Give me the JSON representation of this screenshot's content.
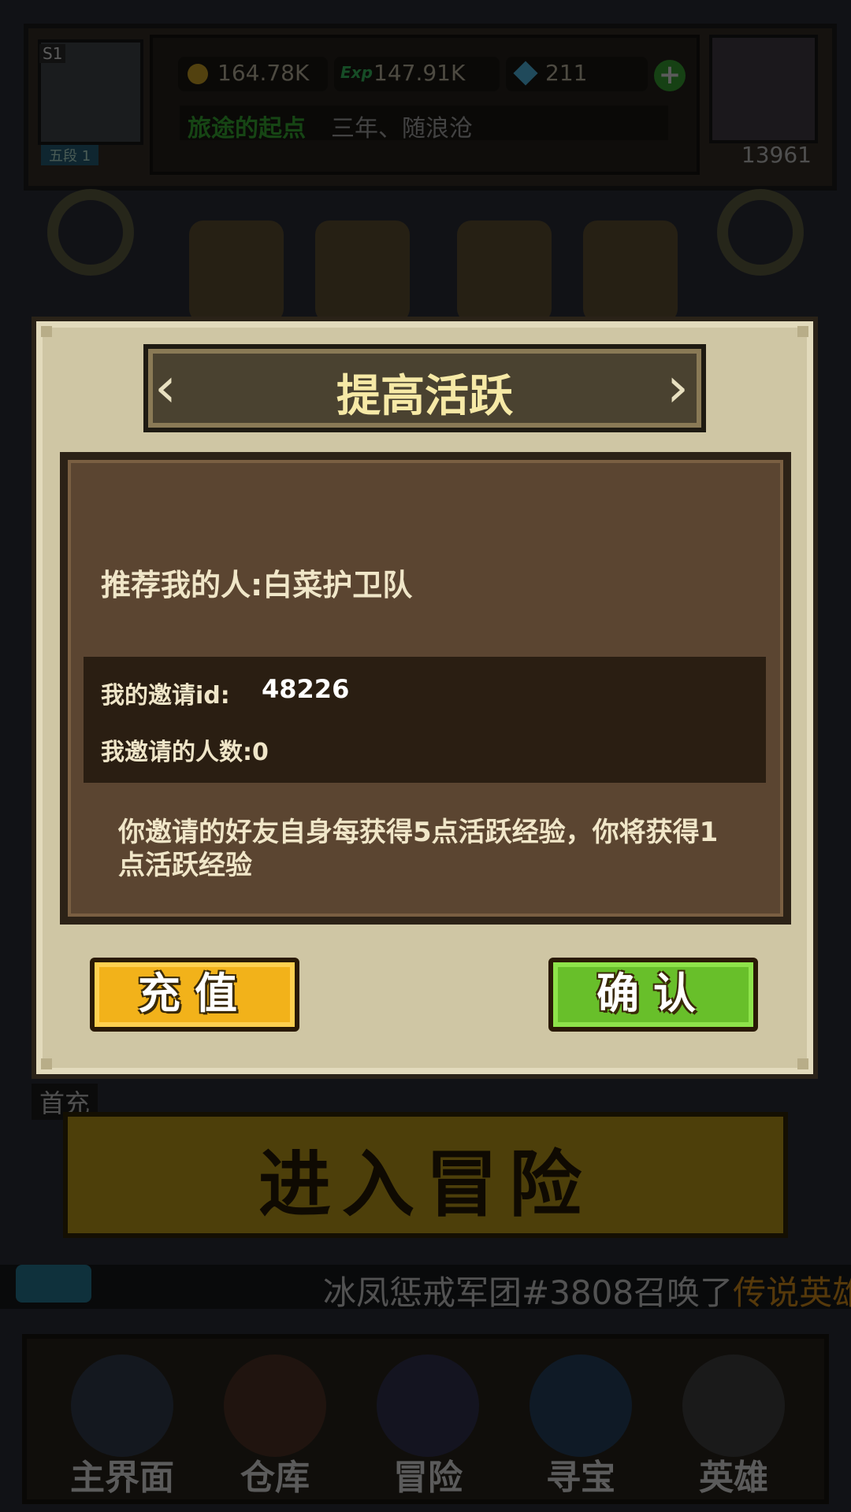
{
  "background": {
    "season": "S1",
    "avatar_rank": "五段 1",
    "stats": {
      "coins": "164.78K",
      "exp_label": "Exp",
      "exp": "147.91K",
      "gems": "211"
    },
    "region": "旅途的起点",
    "player_name": "三年、随浪沧",
    "power": "13961",
    "first_charge": "首充",
    "enter_button": "进入冒险",
    "ticker": {
      "text": "冰凤惩戒军团#3808召唤了",
      "highlight": "传说英雄"
    },
    "nav": [
      {
        "label": "主界面",
        "icon": "home-icon"
      },
      {
        "label": "仓库",
        "icon": "chest-icon"
      },
      {
        "label": "冒险",
        "icon": "sword-icon"
      },
      {
        "label": "寻宝",
        "icon": "crystal-icon"
      },
      {
        "label": "英雄",
        "icon": "skull-icon"
      }
    ]
  },
  "modal": {
    "title": "提高活跃",
    "referrer": "推荐我的人:白菜护卫队",
    "invite_id_label": "我的邀请id:",
    "invite_id_value": "48226",
    "invite_count": "我邀请的人数:0",
    "description": "你邀请的好友自身每获得5点活跃经验，你将获得1点活跃经验",
    "recharge_button": "充值",
    "confirm_button": "确认"
  },
  "colors": {
    "title_text": "#f6e9a6",
    "recharge": "#f2b21a",
    "confirm": "#68bf2a",
    "panel": "#5b4531"
  }
}
